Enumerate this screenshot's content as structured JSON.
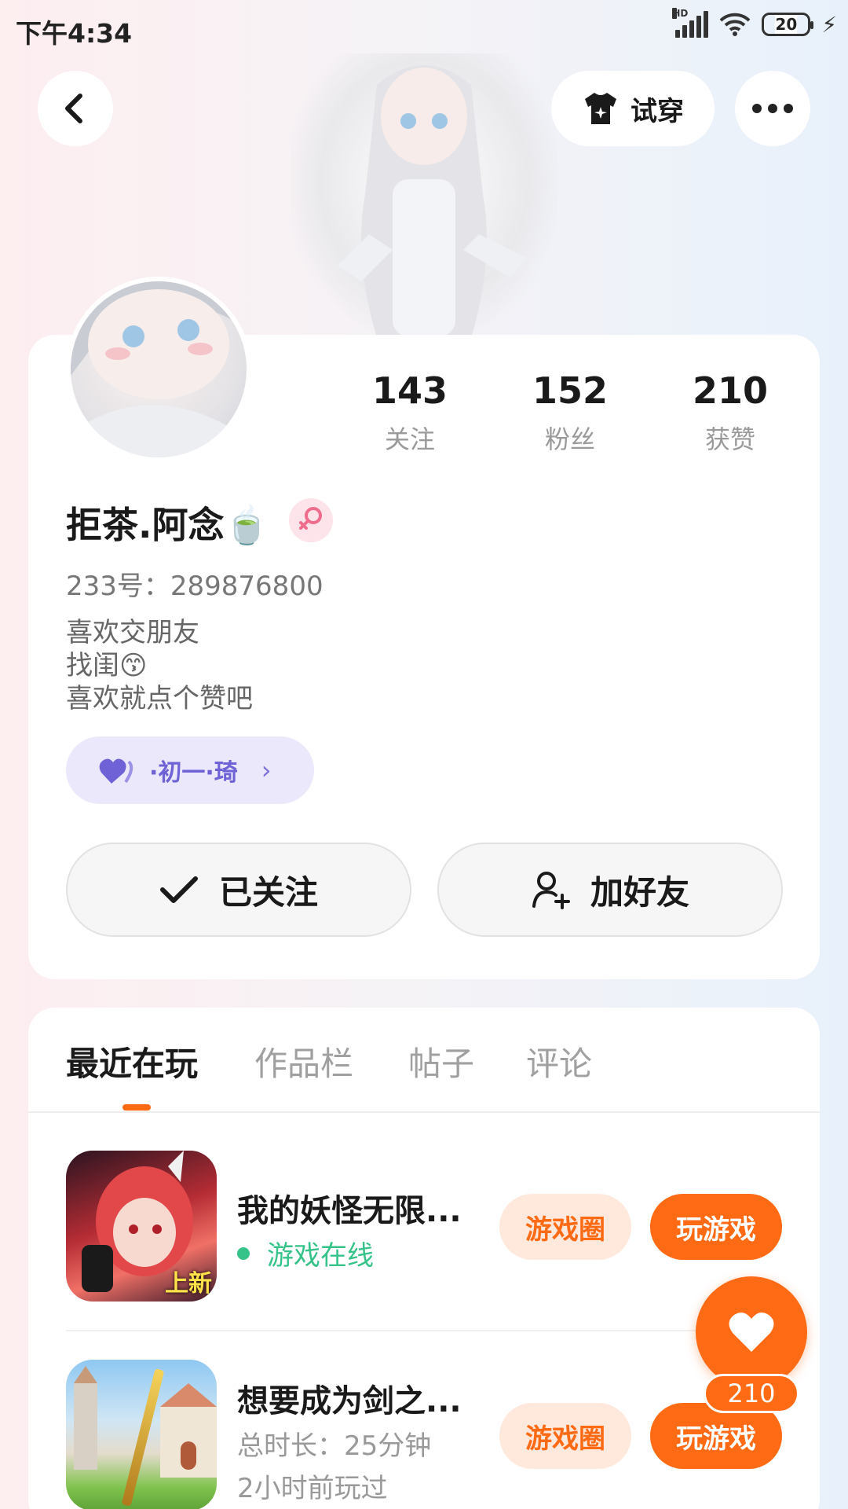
{
  "status_bar": {
    "time": "下午4:34",
    "network": "HD",
    "battery": "20"
  },
  "header": {
    "try_on_label": "试穿"
  },
  "profile": {
    "stats": [
      {
        "value": "143",
        "label": "关注"
      },
      {
        "value": "152",
        "label": "粉丝"
      },
      {
        "value": "210",
        "label": "获赞"
      }
    ],
    "name": "拒茶.阿念🍵",
    "user_id": "233号：289876800",
    "bio": [
      "喜欢交朋友",
      "找闺😙",
      "喜欢就点个赞吧"
    ],
    "relation_tag": "·初一·琦",
    "follow_button": "已关注",
    "add_friend_button": "加好友"
  },
  "tabs": [
    {
      "label": "最近在玩",
      "active": true
    },
    {
      "label": "作品栏",
      "active": false
    },
    {
      "label": "帖子",
      "active": false
    },
    {
      "label": "评论",
      "active": false
    }
  ],
  "games": [
    {
      "title": "我的妖怪无限...",
      "status": "游戏在线",
      "badge": "上新",
      "circle_label": "游戏圈",
      "play_label": "玩游戏"
    },
    {
      "title": "想要成为剑之...",
      "duration": "总时长：25分钟",
      "last_played": "2小时前玩过",
      "circle_label": "游戏圈",
      "play_label": "玩游戏"
    }
  ],
  "like_fab": {
    "count": "210"
  },
  "colors": {
    "accent": "#ff6a14",
    "online": "#35c38a",
    "tag": "#6e62d6"
  }
}
